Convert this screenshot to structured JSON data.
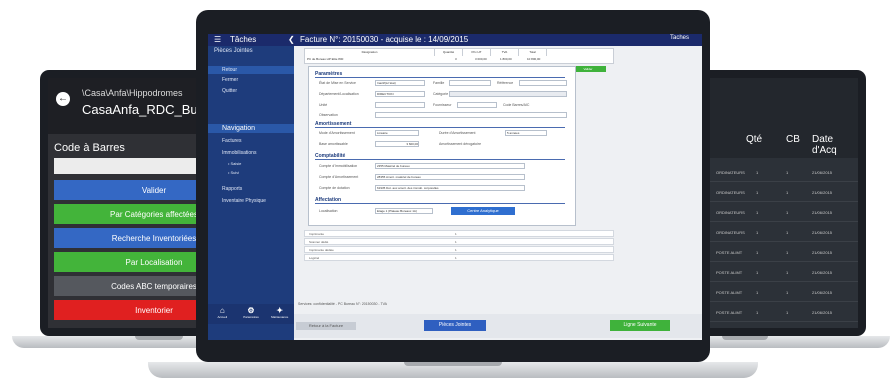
{
  "left": {
    "path": "\\Casa\\Anfa\\Hippodromes",
    "name": "CasaAnfa_RDC_Bure",
    "code_label": "Code à Barres",
    "buttons": [
      {
        "label": "Valider",
        "color": "#3468c4"
      },
      {
        "label": "Par Catégories affectées",
        "color": "#43b43a"
      },
      {
        "label": "Recherche Inventoriées",
        "color": "#3468c4"
      },
      {
        "label": "Par Localisation",
        "color": "#43b43a"
      },
      {
        "label": "Codes ABC temporaires",
        "color": "#55585e"
      },
      {
        "label": "Inventorier",
        "color": "#e02020"
      }
    ]
  },
  "right": {
    "headers": [
      "Qté",
      "CB",
      "Date d'Acq"
    ],
    "rows": [
      [
        "ORDINATEURS",
        "1",
        "1",
        "21/06/2015"
      ],
      [
        "ORDINATEURS",
        "1",
        "1",
        "21/06/2015"
      ],
      [
        "ORDINATEURS",
        "1",
        "1",
        "21/06/2015"
      ],
      [
        "ORDINATEURS",
        "1",
        "1",
        "21/06/2015"
      ],
      [
        "POSTE ALIMT",
        "1",
        "1",
        "21/06/2015"
      ],
      [
        "POSTE ALIMT",
        "1",
        "1",
        "21/06/2015"
      ],
      [
        "POSTE ALIMT",
        "1",
        "1",
        "21/06/2015"
      ],
      [
        "POSTE ALIMT",
        "1",
        "1",
        "21/06/2015"
      ]
    ]
  },
  "center": {
    "top_title": "Tâches",
    "facture": "Facture N°: 20150030 - acquise le : 14/09/2015",
    "top_right": "Taches",
    "side": {
      "pieces": "Pièces Jointes",
      "actions": [
        "Retour",
        "Fermer",
        "Quitter"
      ],
      "navigation": "Navigation",
      "nav_items": [
        "Factures",
        "Immobilisations",
        "Saisie",
        "Inventaire Physique"
      ],
      "nav_sub": [
        "• Saisie",
        "• Suivi"
      ],
      "rapports": "Rapports",
      "bottom": [
        "Accueil",
        "Paramètres",
        "Maintenance"
      ]
    },
    "table": {
      "headers": [
        "Désignation",
        "Quantité",
        "Prix HT",
        "TVA",
        "Total"
      ],
      "row": [
        "PC de Bureau HP Elite 800",
        "3",
        "3 000,00",
        "1 800,00",
        "10 800,00"
      ],
      "valider": "Valider"
    },
    "form": {
      "parametres": "Paramètres",
      "etat_label": "État de Mise en Service",
      "etat_value": "Inactif(à l'état)",
      "famille_label": "Famille",
      "ref_label": "Référence",
      "dep_label": "Département/Localisation",
      "dep_value": "DIRECTION",
      "categorie_label": "Catégorie",
      "unite_label": "Unité",
      "fournisseur_label": "Fournisseur",
      "code_label": "Code Barres/AIC",
      "observ_label": "Observation",
      "amort": "Amortissement",
      "mode_label": "Mode d'Amortissement",
      "mode_value": "Linéaire",
      "duree_label": "Durée d'Amortissement",
      "duree_value": "5 années",
      "base_label": "Base amortissable",
      "base_value": "3 600,00",
      "amort_cb": "Amortissement dérogatoire",
      "compta": "Comptabilité",
      "cpt_immo": "Compte d'Immobilisation",
      "cpt_immo_v": "2355 Matériel de bureau",
      "cpt_amort": "Compte d'Amortissement",
      "cpt_amort_v": "28355 Amort. matériel de bureau",
      "cpt_dot": "Compte de dotation",
      "cpt_dot_v": "61935 Dot. aux amort. des immob. corporelles",
      "affect": "Affectation",
      "local_label": "Localisation",
      "local_value": "Etage 1 (Plateau Bureaux 1A)",
      "centre_btn": "Centre Analytique"
    },
    "lower_rows": [
      {
        "label": "Imprimante",
        "q": "1"
      },
      {
        "label": "Scanner dédié",
        "q": "1"
      },
      {
        "label": "Imprimante dédiée",
        "q": "1"
      },
      {
        "label": "Logiciel",
        "q": "1"
      }
    ],
    "footer": {
      "btn_left": "Retour à la Facture",
      "btn_pieces": "Pièces Jointes",
      "btn_next": "Ligne Suivante",
      "note": "Services: confidentialité - PC Bureau N°: 20150030 - TVA"
    }
  }
}
